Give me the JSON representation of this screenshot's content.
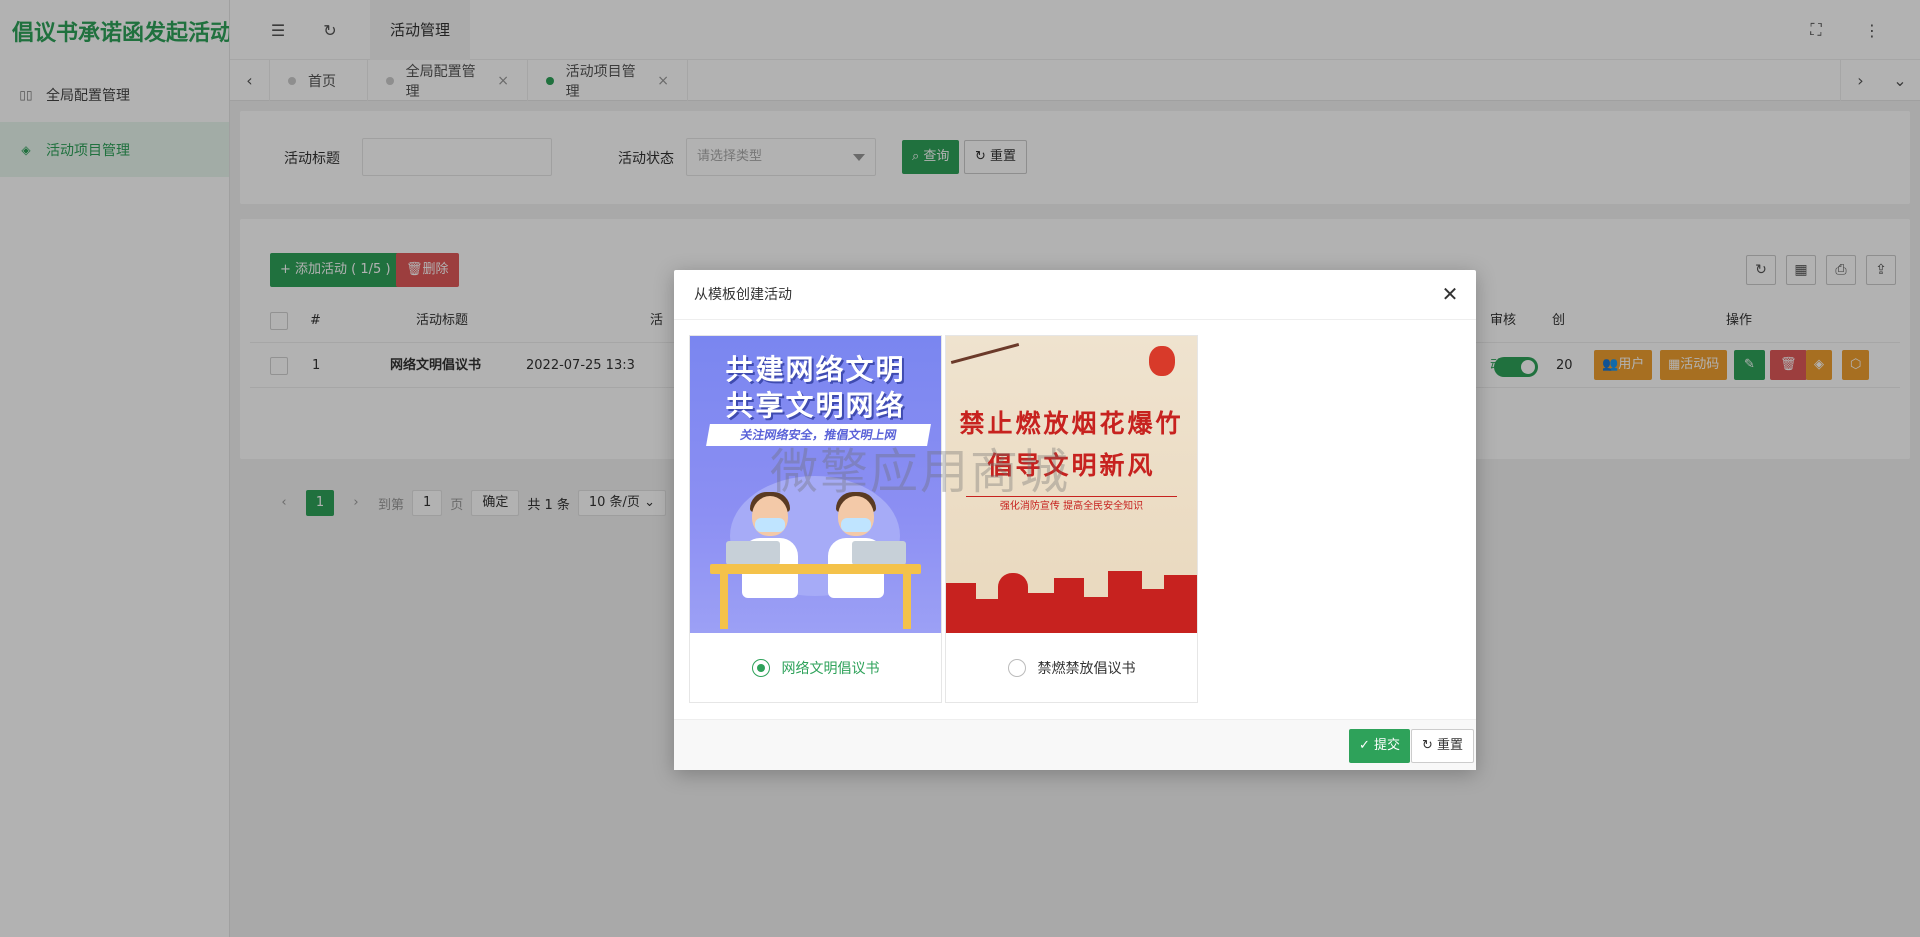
{
  "app": {
    "title": "倡议书承诺函发起活动"
  },
  "sidebar": {
    "items": [
      {
        "label": "全局配置管理",
        "icon": "columns-icon"
      },
      {
        "label": "活动项目管理",
        "icon": "layers-icon",
        "active": true
      }
    ]
  },
  "header": {
    "tab_label": "活动管理"
  },
  "tabs": [
    {
      "label": "首页",
      "closable": false
    },
    {
      "label": "全局配置管理",
      "closable": true
    },
    {
      "label": "活动项目管理",
      "closable": true,
      "active": true
    }
  ],
  "search": {
    "title_label": "活动标题",
    "title_value": "",
    "status_label": "活动状态",
    "status_placeholder": "请选择类型",
    "query_button": "查询",
    "reset_button": "重置"
  },
  "toolbar": {
    "add_button": "添加活动 ( 1/5 )",
    "delete_button": "删除"
  },
  "table": {
    "columns": [
      "#",
      "活动标题",
      "活",
      "审核",
      "创",
      "操作"
    ],
    "rows": [
      {
        "index": "1",
        "title": "网络文明倡议书",
        "time": "2022-07-25 13:3",
        "status_text": "动",
        "created": "20"
      }
    ],
    "actions": {
      "user": "用户",
      "code": "活动码"
    }
  },
  "pager": {
    "current": "1",
    "goto_label": "到第",
    "goto_value": "1",
    "page_label": "页",
    "confirm": "确定",
    "total": "共 1 条",
    "page_size": "10 条/页"
  },
  "modal": {
    "title": "从模板创建活动",
    "templates": [
      {
        "name": "网络文明倡议书",
        "selected": true,
        "poster_line1": "共建网络文明",
        "poster_line2": "共享文明网络",
        "poster_banner": "关注网络安全，推倡文明上网"
      },
      {
        "name": "禁燃禁放倡议书",
        "selected": false,
        "poster_line1": "禁止燃放烟花爆竹",
        "poster_line2": "倡导文明新风",
        "poster_banner": "强化消防宣传 提高全民安全知识"
      }
    ],
    "submit_button": "提交",
    "reset_button": "重置"
  },
  "watermark": "微擎应用商城",
  "colors": {
    "accent": "#2ea25a",
    "danger": "#e05a5a",
    "warning": "#f0a030"
  }
}
